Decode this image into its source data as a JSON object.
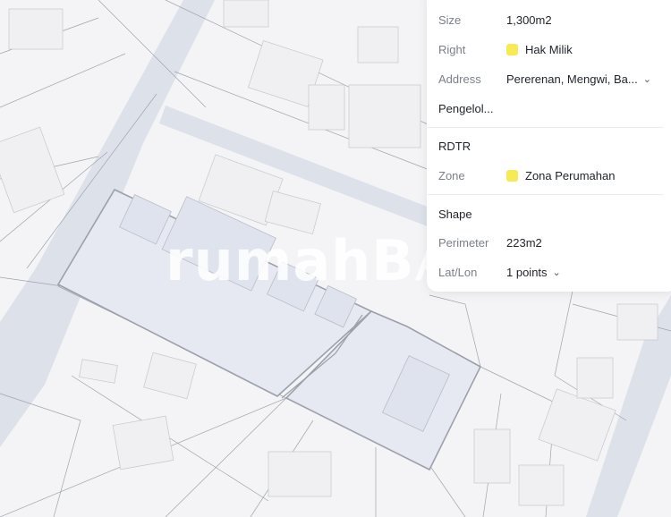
{
  "watermark": {
    "bold": "rumahB",
    "light": "A"
  },
  "panel": {
    "size": {
      "label": "Size",
      "value": "1,300m2"
    },
    "right": {
      "label": "Right",
      "value": "Hak Milik"
    },
    "address": {
      "label": "Address",
      "value": "Pererenan, Mengwi, Ba..."
    },
    "pengelola": {
      "label": "Pengelol..."
    },
    "rdtr_title": "RDTR",
    "zone": {
      "label": "Zone",
      "value": "Zona Perumahan"
    },
    "shape_title": "Shape",
    "perimeter": {
      "label": "Perimeter",
      "value": "223m2"
    },
    "latlon": {
      "label": "Lat/Lon",
      "value": "1 points"
    }
  },
  "colors": {
    "zone_swatch": "#f7ea54",
    "parcel_fill": "#e6e9f1",
    "parcel_stroke": "#9aa1ab"
  },
  "icons": {
    "address_toggle": "chevron-down-icon",
    "latlon_toggle": "chevron-down-icon"
  }
}
